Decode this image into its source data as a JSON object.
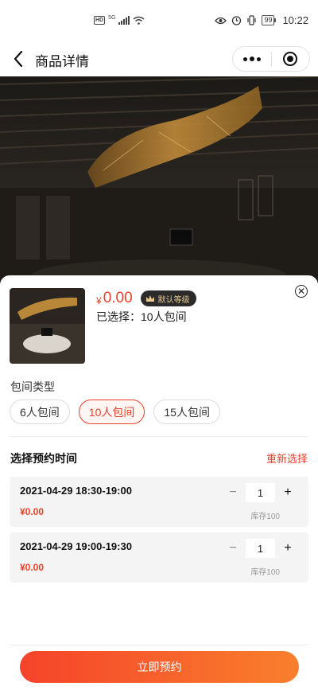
{
  "status_bar": {
    "network": "5G",
    "hd": "HD",
    "battery": "99",
    "time": "10:22"
  },
  "nav": {
    "title": "商品详情"
  },
  "product": {
    "price_symbol": "¥",
    "price": "0.00",
    "level_badge": "默认等级",
    "selected": "已选择：10人包间"
  },
  "room_type": {
    "label": "包间类型",
    "options": [
      "6人包间",
      "10人包间",
      "15人包间"
    ],
    "selected_index": 1
  },
  "booking": {
    "header": "选择预约时间",
    "reselect": "重新选择",
    "slots": [
      {
        "time": "2021-04-29 18:30-19:00",
        "price": "¥0.00",
        "qty": "1",
        "stock": "库存100"
      },
      {
        "time": "2021-04-29 19:00-19:30",
        "price": "¥0.00",
        "qty": "1",
        "stock": "库存100"
      }
    ]
  },
  "footer": {
    "book_label": "立即预约"
  },
  "colors": {
    "accent": "#e8412b",
    "button_gradient_start": "#f5432b",
    "button_gradient_end": "#f97f2c",
    "badge_bg": "#2b2b2b",
    "badge_text": "#e6c98f"
  },
  "icons": [
    "back-arrow-icon",
    "more-dots-icon",
    "target-icon",
    "close-circle-icon",
    "crown-icon",
    "minus-icon",
    "plus-icon"
  ]
}
